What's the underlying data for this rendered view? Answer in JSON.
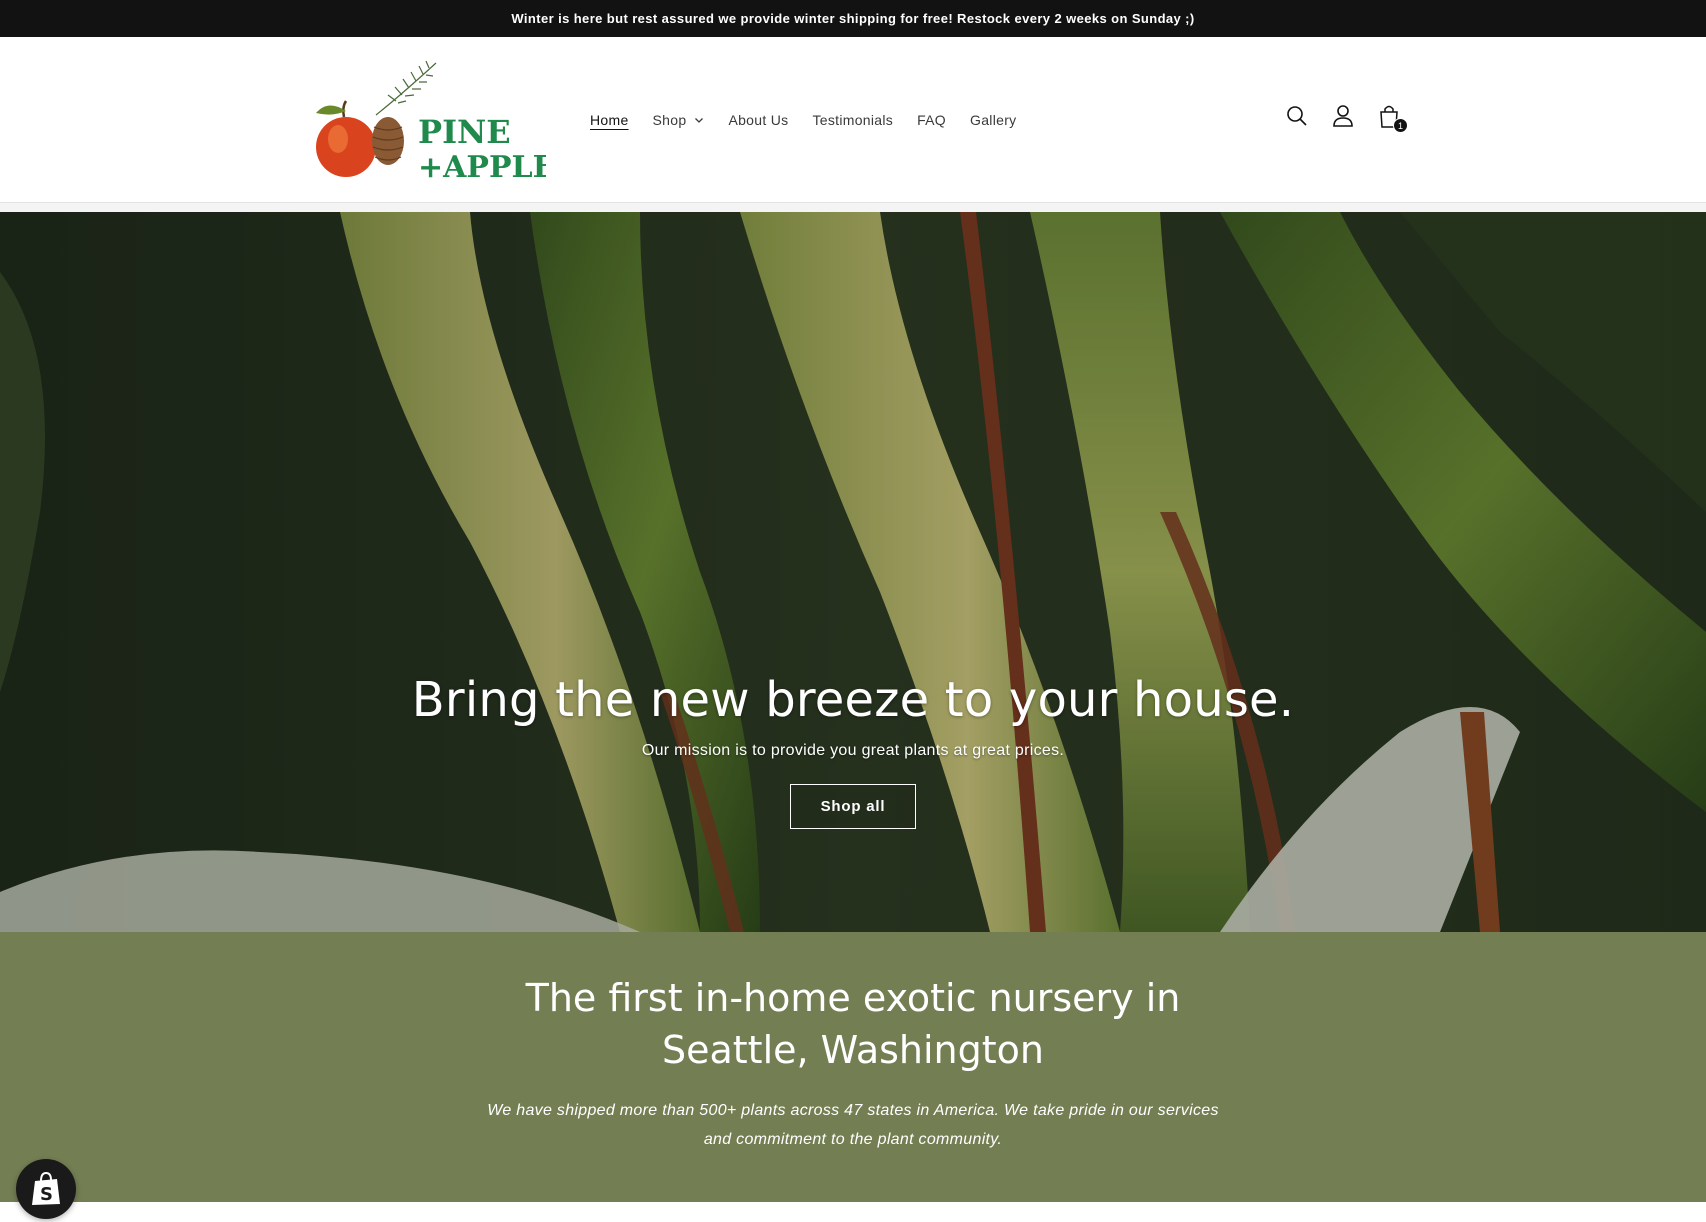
{
  "announcement": {
    "text": "Winter is here but rest assured we provide winter shipping for free! Restock every 2 weeks on Sunday ;)"
  },
  "header": {
    "logo": {
      "line1": "PINE",
      "line2": "+APPLE"
    },
    "nav": [
      {
        "label": "Home",
        "active": true
      },
      {
        "label": "Shop",
        "has_dropdown": true
      },
      {
        "label": "About Us"
      },
      {
        "label": "Testimonials"
      },
      {
        "label": "FAQ"
      },
      {
        "label": "Gallery"
      }
    ],
    "icons": [
      "search-icon",
      "account-icon",
      "cart-icon"
    ],
    "cart_count": "1"
  },
  "hero": {
    "title": "Bring the new breeze to your house.",
    "subtitle": "Our mission is to provide you great plants at great prices.",
    "button_label": "Shop all"
  },
  "intro": {
    "title": "The first in-home exotic nursery in Seattle, Washington",
    "text": "We have shipped more than 500+ plants across 47 states in America. We take pride in our services and commitment to the plant community."
  },
  "colors": {
    "announcement_bg": "#121212",
    "intro_bg": "#737e53",
    "logo_green": "#1f8a4c"
  }
}
